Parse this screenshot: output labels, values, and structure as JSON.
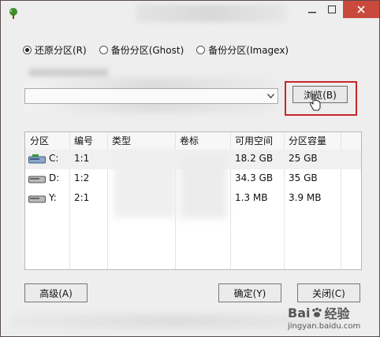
{
  "radios": [
    {
      "label": "还原分区(R)",
      "checked": true
    },
    {
      "label": "备份分区(Ghost)",
      "checked": false
    },
    {
      "label": "备份分区(Imagex)",
      "checked": false
    }
  ],
  "browse_label": "浏览(B)",
  "table": {
    "headers": [
      "分区",
      "编号",
      "类型",
      "卷标",
      "可用空间",
      "分区容量"
    ],
    "rows": [
      {
        "part": "C:",
        "num": "1:1",
        "free": "18.2 GB",
        "cap": "25 GB"
      },
      {
        "part": "D:",
        "num": "1:2",
        "free": "34.3 GB",
        "cap": "35 GB"
      },
      {
        "part": "Y:",
        "num": "2:1",
        "free": "1.3 MB",
        "cap": "3.9 MB"
      }
    ]
  },
  "buttons": {
    "advanced": "高级(A)",
    "ok": "确定(Y)",
    "close": "关闭(C)"
  },
  "watermark": {
    "brand_left": "Bai",
    "brand_right": "经验",
    "url": "jingyan.baidu.com"
  },
  "colors": {
    "highlight": "#c8262a",
    "close_button": "#c94a3d"
  }
}
